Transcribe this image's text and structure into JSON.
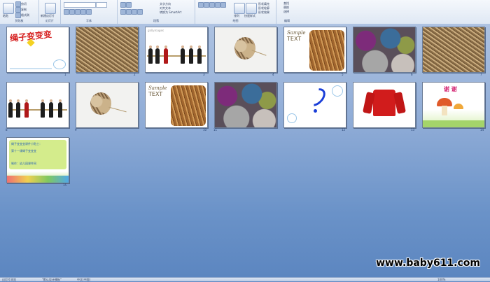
{
  "ribbon": {
    "groups": [
      {
        "label": "剪贴板"
      },
      {
        "label": "幻灯片"
      },
      {
        "label": "字体"
      },
      {
        "label": "段落"
      },
      {
        "label": "绘图"
      },
      {
        "label": "编辑"
      }
    ],
    "clipboard": {
      "cut": "剪切",
      "copy": "复制",
      "format_painter": "格式刷",
      "paste": "粘贴"
    },
    "slides": {
      "new_slide": "新建幻灯片",
      "layout": "版式",
      "reset": "重设",
      "delete": "删除"
    },
    "paragraph": {
      "text_direction": "文字方向",
      "align_text": "对齐文本",
      "smartart": "转换为 SmartArt"
    },
    "drawing": {
      "arrange": "排列",
      "quick_styles": "快速样式",
      "shape_fill": "形状填充",
      "shape_outline": "形状轮廓",
      "shape_effects": "形状效果"
    },
    "editing": {
      "find": "查找",
      "replace": "替换",
      "select": "选择"
    }
  },
  "slides": [
    {
      "num": "1",
      "title": "绳子变变变"
    },
    {
      "num": "2"
    },
    {
      "num": "3",
      "logo": "gallymages"
    },
    {
      "num": "4"
    },
    {
      "num": "5",
      "sample": "Sample",
      "text": "TEXT"
    },
    {
      "num": "6"
    },
    {
      "num": "7"
    },
    {
      "num": "8"
    },
    {
      "num": "9"
    },
    {
      "num": "10",
      "sample": "Sample",
      "text": "TEXT"
    },
    {
      "num": "11"
    },
    {
      "num": "12"
    },
    {
      "num": "13"
    },
    {
      "num": "14",
      "title": "谢 谢"
    },
    {
      "num": "15",
      "body1": "绳子变变变课件小贴士：",
      "body2": "第十一课绳子变变变",
      "body3": "制作：幼儿园课件网"
    }
  ],
  "status": {
    "view": "幻灯片浏览",
    "theme": "\"默认设计模板\"",
    "lang": "中文(中国)",
    "zoom": "100%"
  },
  "watermark": "www.baby611.com",
  "colors": {
    "background": "#6a92c8",
    "ribbon": "#dfe8f4"
  }
}
